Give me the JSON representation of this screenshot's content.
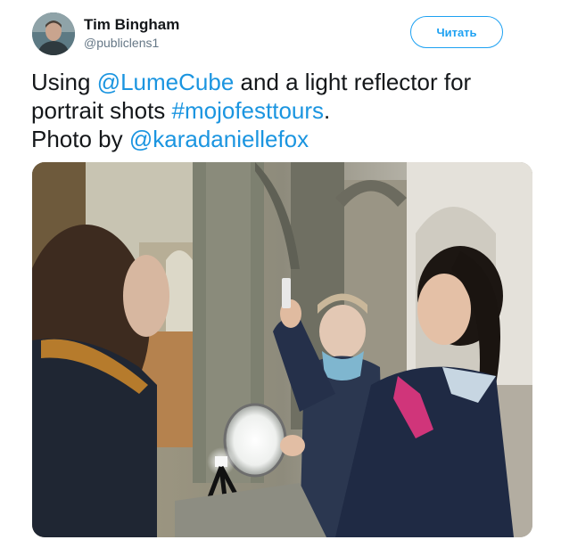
{
  "author": {
    "name": "Tim Bingham",
    "handle": "@publiclens1",
    "avatar_icon": "user-avatar"
  },
  "follow_button": {
    "label": "Читать"
  },
  "tweet": {
    "line1": {
      "before": "Using ",
      "mention": "@LumeCube",
      "after": " and a light reflector for"
    },
    "line2": {
      "before": "portrait shots ",
      "hashtag": "#mojofesttours",
      "after": "."
    },
    "line3": {
      "before": "Photo by ",
      "mention": "@karadaniellefox"
    }
  },
  "media": {
    "type": "photo"
  },
  "colors": {
    "link": "#1b95e0",
    "button": "#1da1f2",
    "text": "#14171a",
    "secondary": "#657786"
  }
}
